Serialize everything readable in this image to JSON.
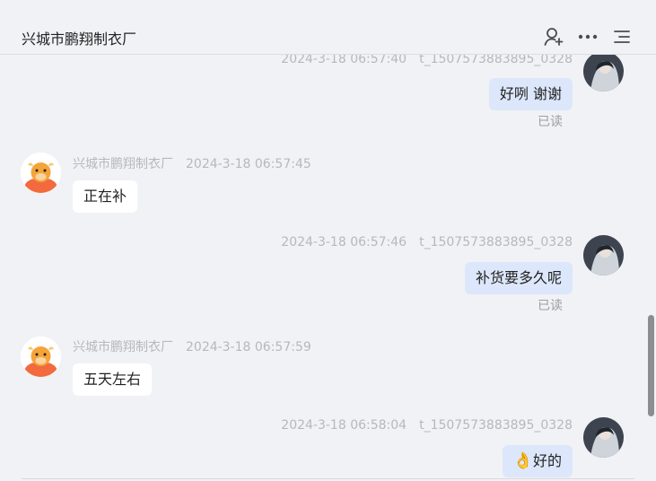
{
  "header": {
    "title": "兴城市鹏翔制衣厂",
    "icons": [
      "add-contact-icon",
      "more-icon",
      "menu-icon"
    ]
  },
  "messages": [
    {
      "side": "right",
      "time": "2024-3-18 06:57:40",
      "sender": "t_1507573883895_0328",
      "text": "好咧 谢谢",
      "status": "已读"
    },
    {
      "side": "left",
      "sender": "兴城市鹏翔制衣厂",
      "time": "2024-3-18 06:57:45",
      "text": "正在补"
    },
    {
      "side": "right",
      "time": "2024-3-18 06:57:46",
      "sender": "t_1507573883895_0328",
      "text": "补货要多久呢",
      "status": "已读"
    },
    {
      "side": "left",
      "sender": "兴城市鹏翔制衣厂",
      "time": "2024-3-18 06:57:59",
      "text": "五天左右"
    },
    {
      "side": "right",
      "time": "2024-3-18 06:58:04",
      "sender": "t_1507573883895_0328",
      "emoji": "👌",
      "text": "好的"
    }
  ],
  "colors": {
    "background": "#f1f2f5",
    "outgoing_bubble": "#dde7fb",
    "incoming_bubble": "#ffffff",
    "meta_text": "#b6b8bd"
  }
}
